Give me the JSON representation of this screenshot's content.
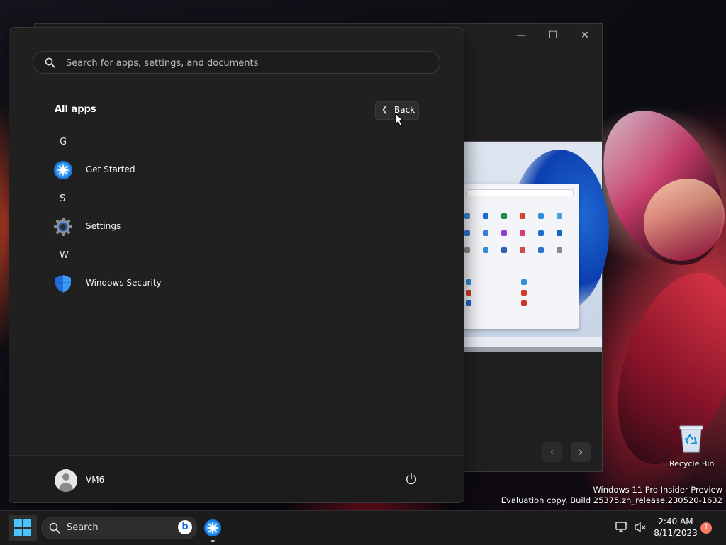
{
  "start_menu": {
    "search_placeholder": "Search for apps, settings, and documents",
    "section_title": "All apps",
    "back_label": "Back",
    "groups": [
      {
        "letter": "G",
        "apps": [
          {
            "name": "Get Started",
            "icon": "get-started-icon"
          }
        ]
      },
      {
        "letter": "S",
        "apps": [
          {
            "name": "Settings",
            "icon": "settings-gear-icon"
          }
        ]
      },
      {
        "letter": "W",
        "apps": [
          {
            "name": "Windows Security",
            "icon": "shield-icon"
          }
        ]
      }
    ],
    "user": {
      "name": "VM6"
    }
  },
  "desktop": {
    "recycle_bin_label": "Recycle Bin",
    "watermark_line1": "Windows 11 Pro Insider Preview",
    "watermark_line2": "Evaluation copy. Build 25375.zn_release.230520-1632"
  },
  "taskbar": {
    "search_label": "Search",
    "time": "2:40 AM",
    "date": "8/11/2023",
    "notification_count": "1",
    "bing_letter": "b"
  },
  "colors": {
    "accent": "#0067c0",
    "start_bg": "#202020",
    "taskbar_bg": "#1b1b1b",
    "notification_badge": "#f47a62"
  }
}
